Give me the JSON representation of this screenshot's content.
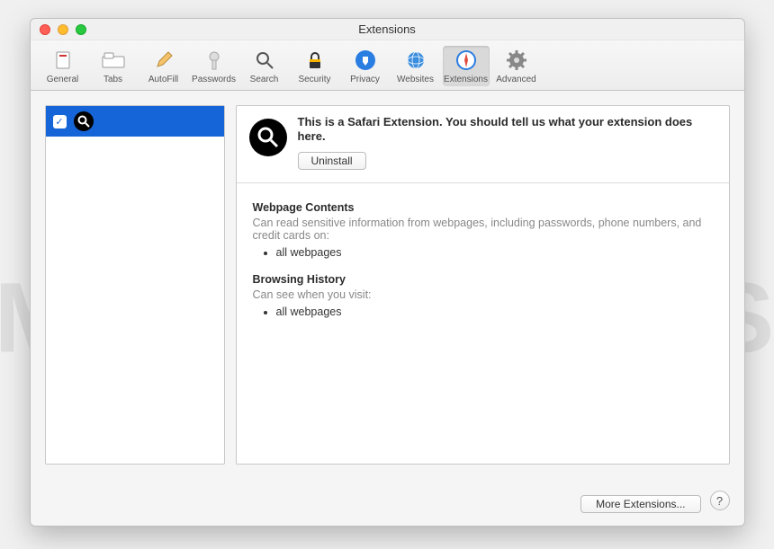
{
  "window": {
    "title": "Extensions"
  },
  "toolbar": {
    "items": [
      {
        "label": "General"
      },
      {
        "label": "Tabs"
      },
      {
        "label": "AutoFill"
      },
      {
        "label": "Passwords"
      },
      {
        "label": "Search"
      },
      {
        "label": "Security"
      },
      {
        "label": "Privacy"
      },
      {
        "label": "Websites"
      },
      {
        "label": "Extensions"
      },
      {
        "label": "Advanced"
      }
    ]
  },
  "sidebar": {
    "items": [
      {
        "checked": true,
        "icon": "search-icon"
      }
    ]
  },
  "detail": {
    "description": "This is a Safari Extension. You should tell us what your extension does here.",
    "uninstall_label": "Uninstall",
    "permissions": [
      {
        "title": "Webpage Contents",
        "desc": "Can read sensitive information from webpages, including passwords, phone numbers, and credit cards on:",
        "items": [
          "all webpages"
        ]
      },
      {
        "title": "Browsing History",
        "desc": "Can see when you visit:",
        "items": [
          "all webpages"
        ]
      }
    ]
  },
  "footer": {
    "more_label": "More Extensions...",
    "help_label": "?"
  },
  "watermark": "MALWARETIPS"
}
